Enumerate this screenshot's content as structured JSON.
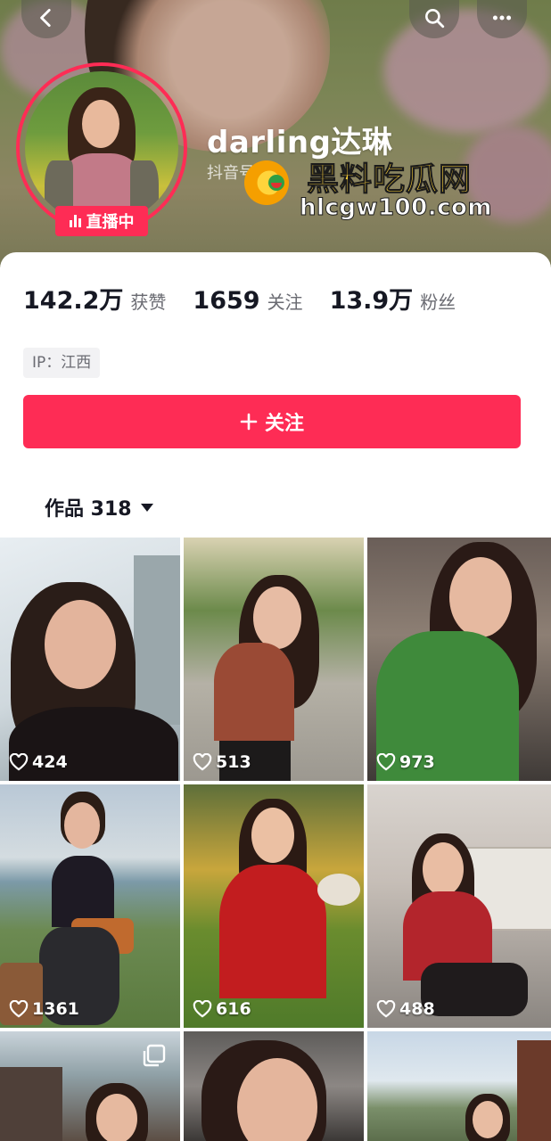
{
  "header": {
    "nickname": "darling达琳",
    "account_id_partial": "抖音号",
    "live_badge": "直播中"
  },
  "watermark": {
    "title": "黑料吃瓜网",
    "url": "hlcgw100.com"
  },
  "icons": {
    "back": "chevron-left-icon",
    "search": "search-icon",
    "more": "more-dots-icon"
  },
  "stats": [
    {
      "value": "142.2万",
      "label": "获赞"
    },
    {
      "value": "1659",
      "label": "关注"
    },
    {
      "value": "13.9万",
      "label": "粉丝"
    }
  ],
  "ip_tag": "IP：江西",
  "follow_button": "关注",
  "works_tab": "作品 318",
  "colors": {
    "accent": "#fe2c55"
  },
  "videos": [
    {
      "likes": "424"
    },
    {
      "likes": "513"
    },
    {
      "likes": "973"
    },
    {
      "likes": "1361"
    },
    {
      "likes": "616"
    },
    {
      "likes": "488"
    },
    {
      "likes": ""
    },
    {
      "likes": ""
    },
    {
      "likes": ""
    }
  ]
}
